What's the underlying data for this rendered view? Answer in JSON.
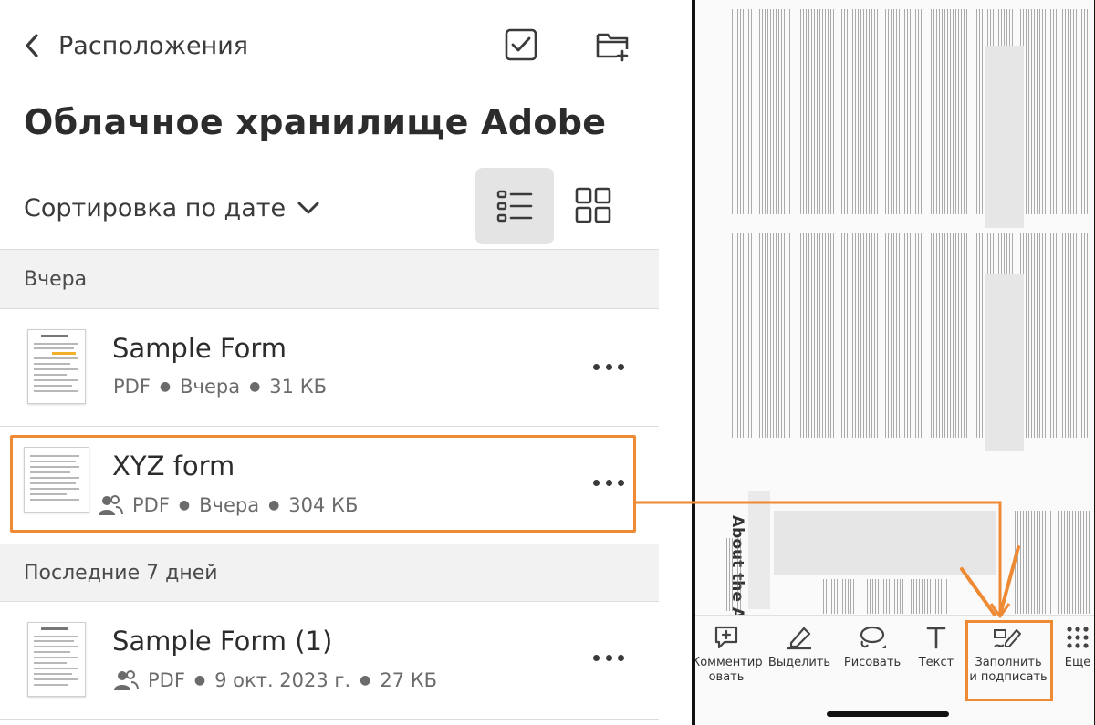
{
  "header": {
    "back_label": "Расположения",
    "title": "Облачное хранилище Adobe",
    "select_icon": "checkbox-icon",
    "new_folder_icon": "folder-plus-icon"
  },
  "sort": {
    "label": "Сортировка по дате",
    "list_view_icon": "list-view-icon",
    "grid_view_icon": "grid-view-icon"
  },
  "sections": [
    {
      "header": "Вчера",
      "files": [
        {
          "name": "Sample Form",
          "type": "PDF",
          "date": "Вчера",
          "size": "31 КБ",
          "shared": false
        },
        {
          "name": "XYZ form",
          "type": "PDF",
          "date": "Вчера",
          "size": "304 КБ",
          "shared": true
        }
      ]
    },
    {
      "header": "Последние 7 дней",
      "files": [
        {
          "name": "Sample Form (1)",
          "type": "PDF",
          "date": "9 окт. 2023 г.",
          "size": "27 КБ",
          "shared": true
        }
      ]
    }
  ],
  "toolbar": {
    "items": [
      {
        "label": "Комментир\nовать",
        "icon": "comment-icon"
      },
      {
        "label": "Выделить",
        "icon": "highlighter-icon"
      },
      {
        "label": "Рисовать",
        "icon": "draw-icon"
      },
      {
        "label": "Текст",
        "icon": "text-icon"
      },
      {
        "label": "Заполнить\nи подписать",
        "icon": "fill-sign-icon"
      },
      {
        "label": "Еще",
        "icon": "more-grid-icon"
      }
    ]
  },
  "colors": {
    "accent": "#ee8a33",
    "text": "#2c2c2c",
    "muted": "#6b6b6b",
    "section_bg": "#f2f2f2"
  },
  "doc": {
    "heading": "About the Auth"
  }
}
